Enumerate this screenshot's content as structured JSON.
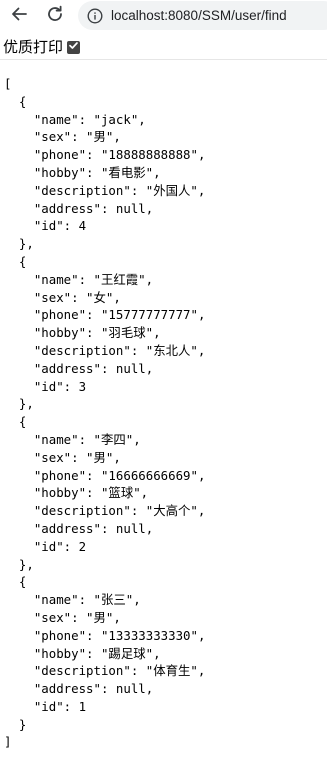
{
  "browser": {
    "url": "localhost:8080/SSM/user/find"
  },
  "print_bar": {
    "label": "优质打印",
    "checked": true
  },
  "json_lines": [
    "[",
    "  {",
    "    \"name\": \"jack\",",
    "    \"sex\": \"男\",",
    "    \"phone\": \"18888888888\",",
    "    \"hobby\": \"看电影\",",
    "    \"description\": \"外国人\",",
    "    \"address\": null,",
    "    \"id\": 4",
    "  },",
    "  {",
    "    \"name\": \"王红霞\",",
    "    \"sex\": \"女\",",
    "    \"phone\": \"15777777777\",",
    "    \"hobby\": \"羽毛球\",",
    "    \"description\": \"东北人\",",
    "    \"address\": null,",
    "    \"id\": 3",
    "  },",
    "  {",
    "    \"name\": \"李四\",",
    "    \"sex\": \"男\",",
    "    \"phone\": \"16666666669\",",
    "    \"hobby\": \"篮球\",",
    "    \"description\": \"大高个\",",
    "    \"address\": null,",
    "    \"id\": 2",
    "  },",
    "  {",
    "    \"name\": \"张三\",",
    "    \"sex\": \"男\",",
    "    \"phone\": \"13333333330\",",
    "    \"hobby\": \"踢足球\",",
    "    \"description\": \"体育生\",",
    "    \"address\": null,",
    "    \"id\": 1",
    "  }",
    "]"
  ]
}
